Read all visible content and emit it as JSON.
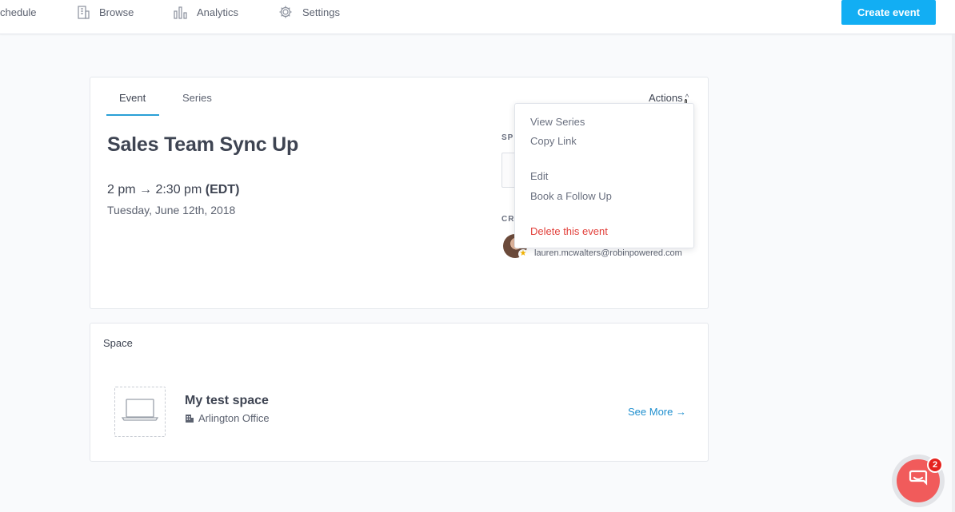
{
  "nav": {
    "items": [
      {
        "label": "chedule",
        "icon": "calendar-icon"
      },
      {
        "label": "Browse",
        "icon": "building-icon"
      },
      {
        "label": "Analytics",
        "icon": "bar-chart-icon"
      },
      {
        "label": "Settings",
        "icon": "gear-icon"
      }
    ],
    "create_button": "Create event"
  },
  "event": {
    "tabs": [
      "Event",
      "Series"
    ],
    "active_tab": "Event",
    "actions_label": "Actions",
    "title": "Sales Team Sync Up",
    "time_range": "2 pm → 2:30 pm",
    "timezone": "(EDT)",
    "date": "Tuesday, June 12th, 2018",
    "side_labels": {
      "space": "SP",
      "creator": "CR"
    },
    "creator_email": "lauren.mcwalters@robinpowered.com"
  },
  "actions_menu": {
    "view_series": "View Series",
    "copy_link": "Copy Link",
    "edit": "Edit",
    "book_follow_up": "Book a Follow Up",
    "delete": "Delete this event"
  },
  "space": {
    "heading": "Space",
    "name": "My test space",
    "location": "Arlington Office",
    "see_more": "See More →"
  },
  "chat": {
    "badge_count": "2"
  },
  "colors": {
    "accent": "#12aef3",
    "tab_underline": "#2a9fd6",
    "danger": "#e2403b",
    "link": "#1f8fcf",
    "chat": "#f15b5b"
  }
}
